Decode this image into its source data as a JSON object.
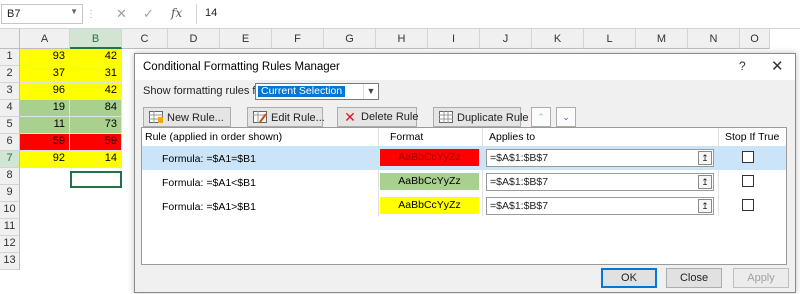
{
  "formula_bar": {
    "name_box": "B7",
    "separator": "⋮",
    "cancel_icon": "✕",
    "enter_icon": "✓",
    "fx_label": "fx",
    "value": "14"
  },
  "columns": [
    "A",
    "B",
    "C",
    "D",
    "E",
    "F",
    "G",
    "H",
    "I",
    "J",
    "K",
    "L",
    "M",
    "N",
    "O"
  ],
  "rows": [
    "1",
    "2",
    "3",
    "4",
    "5",
    "6",
    "7",
    "8",
    "9",
    "10",
    "11",
    "12",
    "13"
  ],
  "cells": [
    {
      "a": "93",
      "b": "42",
      "fill": "#ffff00"
    },
    {
      "a": "37",
      "b": "31",
      "fill": "#ffff00"
    },
    {
      "a": "96",
      "b": "42",
      "fill": "#ffff00"
    },
    {
      "a": "19",
      "b": "84",
      "fill": "#a9d08e"
    },
    {
      "a": "11",
      "b": "73",
      "fill": "#a9d08e"
    },
    {
      "a": "59",
      "b": "59",
      "fill": "#ff0000"
    },
    {
      "a": "92",
      "b": "14",
      "fill": "#ffff00"
    }
  ],
  "dialog": {
    "title": "Conditional Formatting Rules Manager",
    "help": "?",
    "close": "✕",
    "show_label": "Show formatting rules for:",
    "show_value": "Current Selection",
    "toolbar": {
      "new_rule": "New Rule...",
      "edit_rule": "Edit Rule...",
      "delete_rule": "Delete Rule",
      "duplicate_rule": "Duplicate Rule",
      "move_up": "⌃",
      "move_down": "⌄"
    },
    "headers": {
      "rule": "Rule (applied in order shown)",
      "format": "Format",
      "applies": "Applies to",
      "stop": "Stop If True"
    },
    "rules": [
      {
        "rule": "Formula: =$A1=$B1",
        "preview": "AaBbCcYyZz",
        "color": "#ff0000",
        "text_color": "#9c0006",
        "applies": "=$A$1:$B$7"
      },
      {
        "rule": "Formula: =$A1<$B1",
        "preview": "AaBbCcYyZz",
        "color": "#a9d08e",
        "text_color": "#000000",
        "applies": "=$A$1:$B$7"
      },
      {
        "rule": "Formula: =$A1>$B1",
        "preview": "AaBbCcYyZz",
        "color": "#ffff00",
        "text_color": "#000000",
        "applies": "=$A$1:$B$7"
      }
    ],
    "buttons": {
      "ok": "OK",
      "close": "Close",
      "apply": "Apply"
    }
  }
}
